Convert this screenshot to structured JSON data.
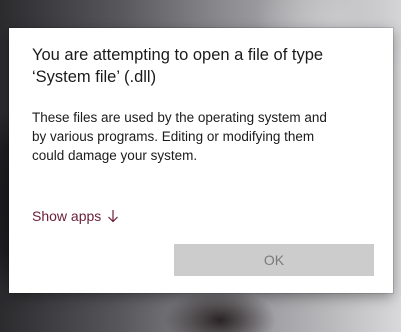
{
  "dialog": {
    "title_line1": "You are attempting to open a file of type",
    "title_line2": "‘System file’ (.dll)",
    "body_line1": "These files are used by the operating system and",
    "body_line2": "by various programs. Editing or modifying them",
    "body_line3": "could damage your system.",
    "show_apps_label": "Show apps",
    "show_apps_icon": "arrow-down-icon",
    "ok_label": "OK"
  },
  "colors": {
    "link": "#6b1d3a",
    "button_disabled_bg": "#cccccc",
    "button_disabled_text": "#7a7a7a",
    "dialog_bg": "#ffffff"
  }
}
